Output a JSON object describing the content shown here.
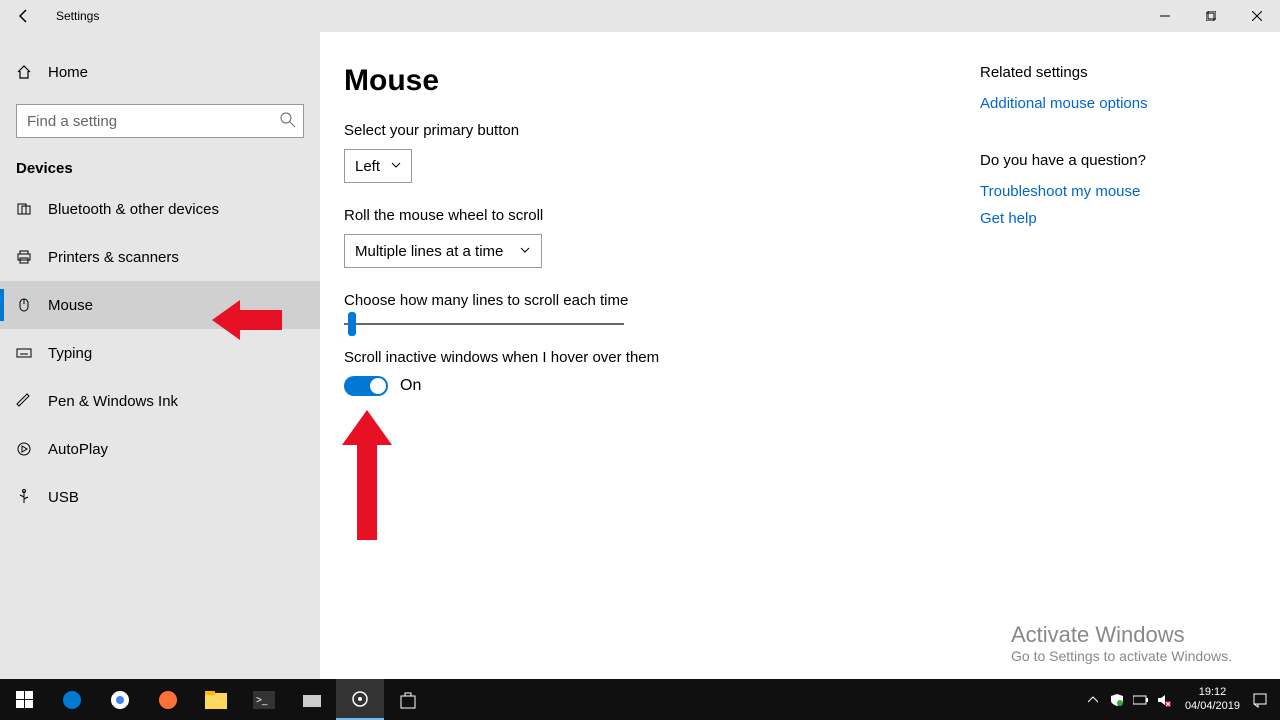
{
  "window": {
    "title": "Settings"
  },
  "sidebar": {
    "home": "Home",
    "search_placeholder": "Find a setting",
    "section": "Devices",
    "items": [
      {
        "label": "Bluetooth & other devices"
      },
      {
        "label": "Printers & scanners"
      },
      {
        "label": "Mouse"
      },
      {
        "label": "Typing"
      },
      {
        "label": "Pen & Windows Ink"
      },
      {
        "label": "AutoPlay"
      },
      {
        "label": "USB"
      }
    ]
  },
  "page": {
    "title": "Mouse",
    "primary_label": "Select your primary button",
    "primary_value": "Left",
    "scroll_label": "Roll the mouse wheel to scroll",
    "scroll_value": "Multiple lines at a time",
    "lines_label": "Choose how many lines to scroll each time",
    "inactive_label": "Scroll inactive windows when I hover over them",
    "toggle_state": "On"
  },
  "related": {
    "heading": "Related settings",
    "link1": "Additional mouse options",
    "question": "Do you have a question?",
    "link2": "Troubleshoot my mouse",
    "link3": "Get help"
  },
  "activate": {
    "title": "Activate Windows",
    "sub": "Go to Settings to activate Windows."
  },
  "tray": {
    "time": "19:12",
    "date": "04/04/2019"
  }
}
